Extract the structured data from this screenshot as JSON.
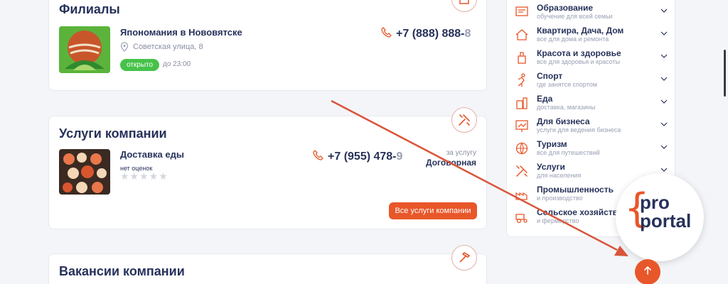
{
  "branches": {
    "title": "Филиалы",
    "item": {
      "name": "Япономания в Нововятске",
      "address": "Советская улица, 8",
      "phone_main": "+7 (888) 888-",
      "phone_fade": "8",
      "status": "открыто",
      "hours": "до 23:00"
    }
  },
  "services": {
    "title": "Услуги компании",
    "item": {
      "name": "Доставка еды",
      "rating_text": "нет оценок",
      "stars": "★★★★★",
      "phone_main": "+7 (955) 478-",
      "phone_fade": "9",
      "price_label": "за услугу",
      "price": "Договорная"
    },
    "all_button": "Все услуги компании"
  },
  "vacancies": {
    "title": "Вакансии компании"
  },
  "sidebar": {
    "categories": [
      {
        "title": "Образование",
        "sub": "обучение для всей семьи",
        "icon": "education-icon"
      },
      {
        "title": "Квартира, Дача, Дом",
        "sub": "все для дома и ремонта",
        "icon": "home-icon"
      },
      {
        "title": "Красота и здоровье",
        "sub": "все для здоровья и красоты",
        "icon": "beauty-icon"
      },
      {
        "title": "Спорт",
        "sub": "где занятся спортом",
        "icon": "sport-icon"
      },
      {
        "title": "Еда",
        "sub": "доставка, магазины",
        "icon": "food-icon"
      },
      {
        "title": "Для бизнеса",
        "sub": "услуги для ведения бизнеса",
        "icon": "business-icon"
      },
      {
        "title": "Туризм",
        "sub": "все для путешествий",
        "icon": "tourism-icon"
      },
      {
        "title": "Услуги",
        "sub": "для населения",
        "icon": "services-icon"
      },
      {
        "title": "Промышленность",
        "sub": "и производство",
        "icon": "industry-icon"
      },
      {
        "title": "Сельское хозяйство",
        "sub": "и фермерство",
        "icon": "agriculture-icon"
      }
    ]
  },
  "logo": {
    "line1": "pro",
    "line2": "portal",
    "brace": "{"
  },
  "colors": {
    "accent": "#e8572a",
    "text": "#27325a",
    "open": "#46c24a"
  }
}
